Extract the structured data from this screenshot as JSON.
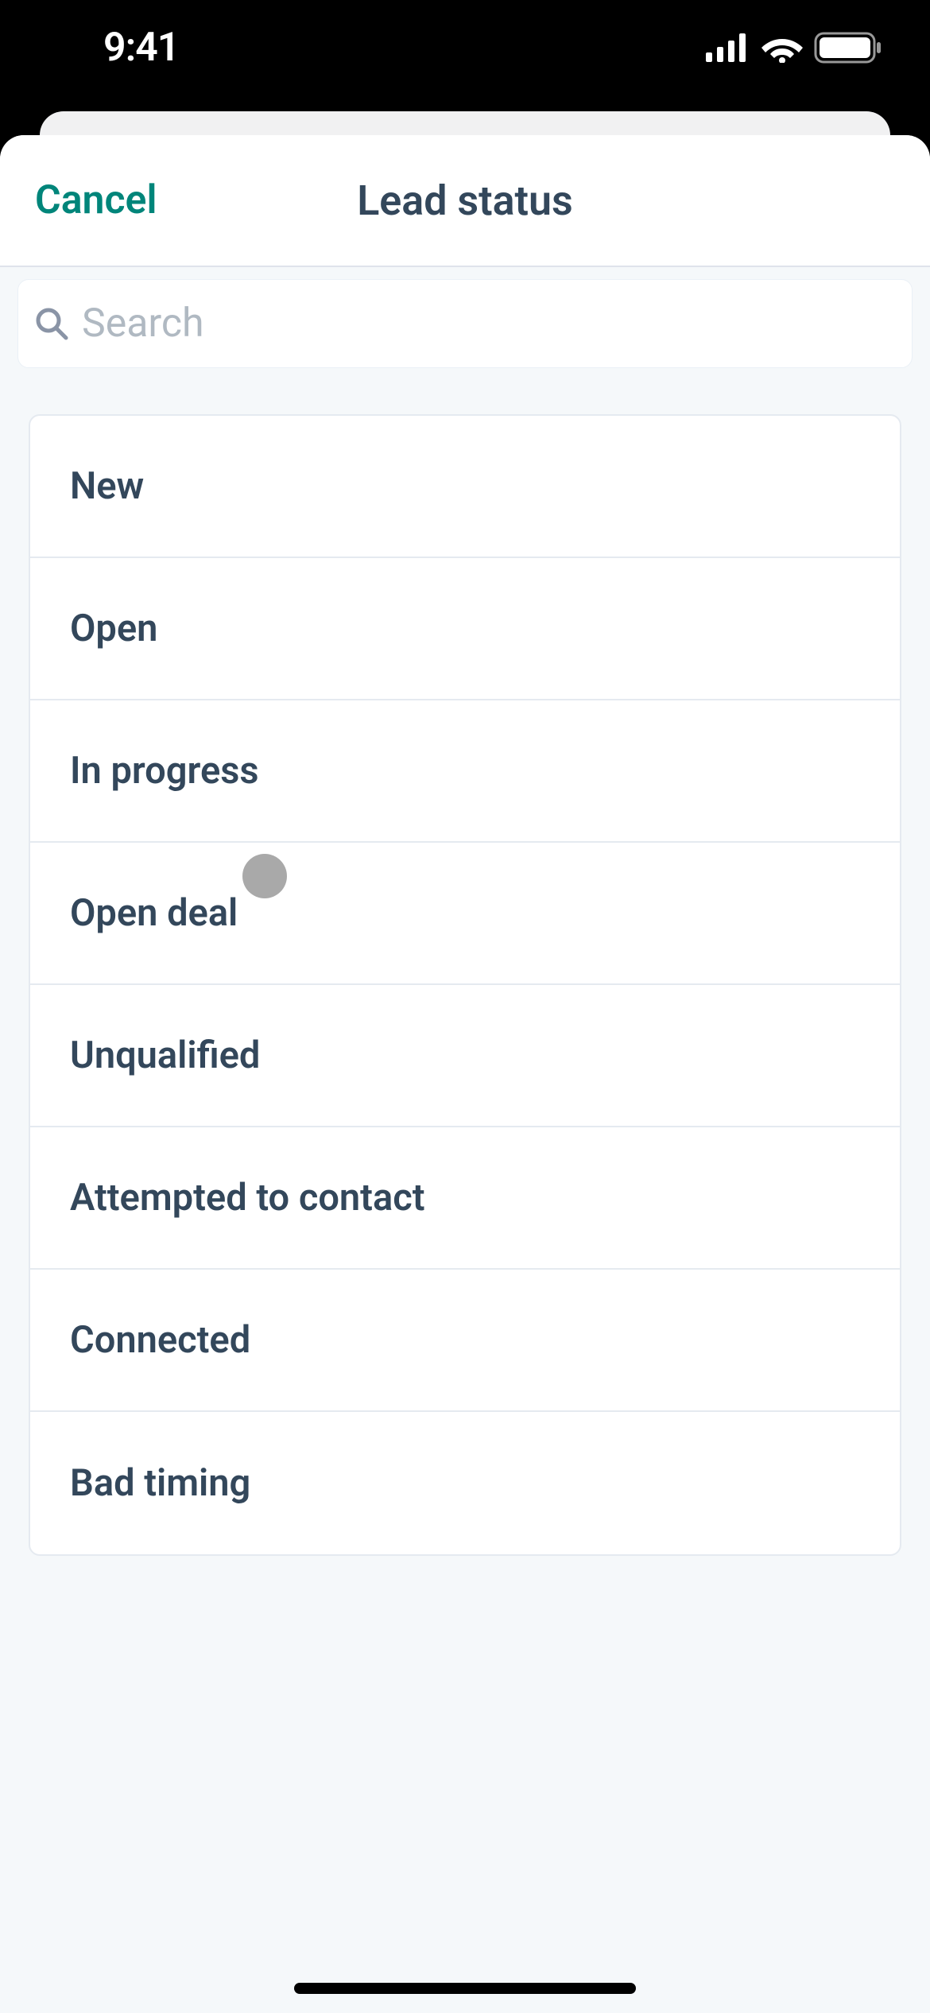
{
  "status_bar": {
    "time": "9:41"
  },
  "header": {
    "cancel": "Cancel",
    "title": "Lead status"
  },
  "search": {
    "placeholder": "Search"
  },
  "options": [
    {
      "label": "New"
    },
    {
      "label": "Open"
    },
    {
      "label": "In progress"
    },
    {
      "label": "Open deal"
    },
    {
      "label": "Unqualified"
    },
    {
      "label": "Attempted to contact"
    },
    {
      "label": "Connected"
    },
    {
      "label": "Bad timing"
    }
  ]
}
